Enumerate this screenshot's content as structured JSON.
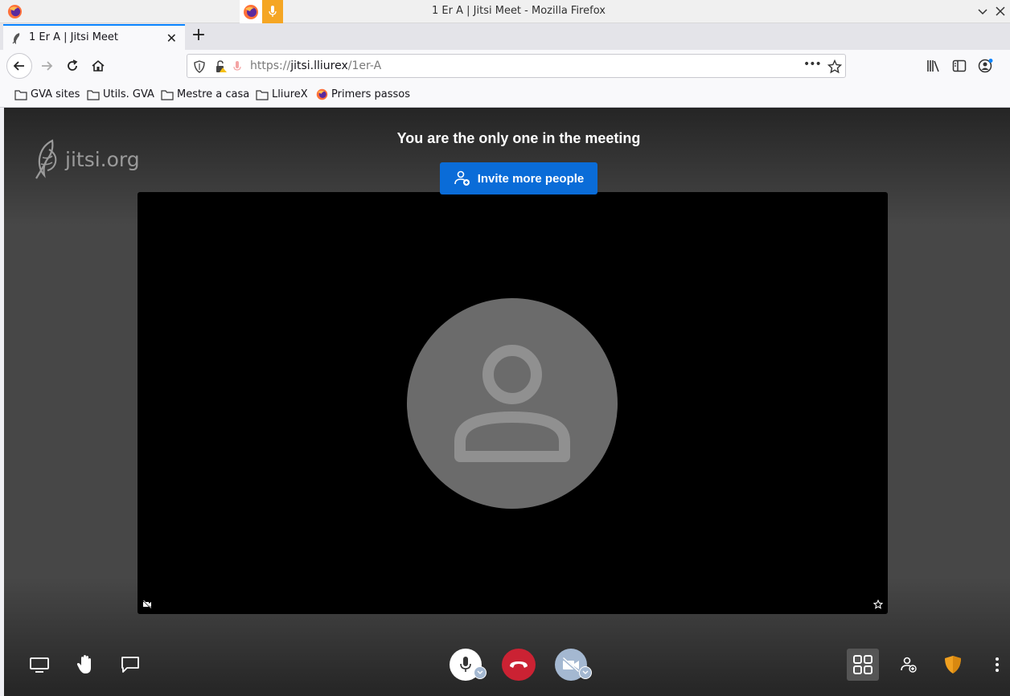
{
  "window": {
    "title": "1 Er A | Jitsi Meet - Mozilla Firefox"
  },
  "tab": {
    "label": "1 Er A | Jitsi Meet",
    "close": "✕",
    "new_tab": "+"
  },
  "urlbar": {
    "url_prefix": "https://",
    "url_host": "jitsi.lliurex",
    "url_path": "/1er-A",
    "page_actions": "•••"
  },
  "bookmarks": [
    {
      "label": "GVA sites",
      "icon": "folder-icon"
    },
    {
      "label": "Utils. GVA",
      "icon": "folder-icon"
    },
    {
      "label": "Mestre a casa",
      "icon": "folder-icon"
    },
    {
      "label": "LliureX",
      "icon": "folder-icon"
    },
    {
      "label": "Primers passos",
      "icon": "firefox-icon"
    }
  ],
  "meeting": {
    "logo_text": "jitsi.org",
    "status_text": "You are the only one in the meeting",
    "invite_label": "Invite more people"
  },
  "colors": {
    "invite_button": "#0a6cd8",
    "hangup_button": "#cb2233",
    "camera_button": "#a4b8d1",
    "security_shield": "#f0a020",
    "tab_accent": "#0a84ff"
  }
}
